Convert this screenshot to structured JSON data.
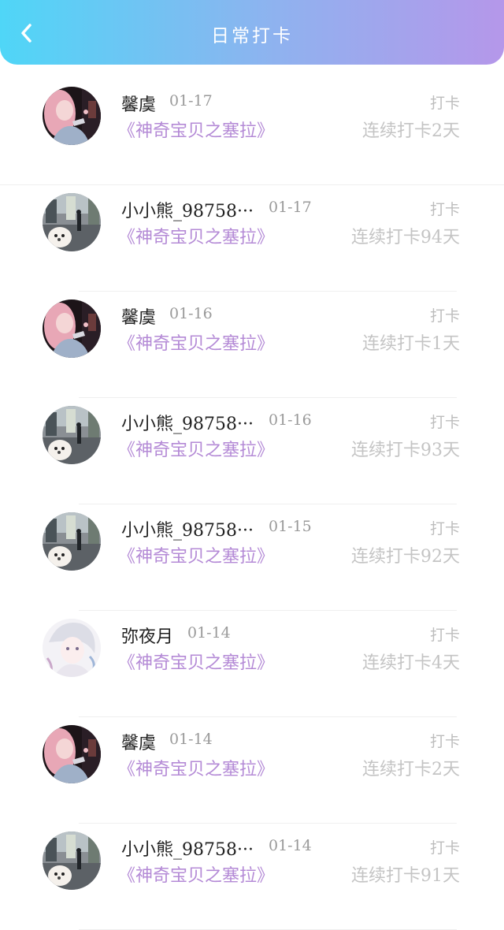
{
  "header": {
    "title": "日常打卡",
    "gradient_start": "#4fd6f7",
    "gradient_end": "#b597ea",
    "back_icon": "chevron-left-icon"
  },
  "items": [
    {
      "user": "馨虞",
      "date": "01-17",
      "book": "《神奇宝贝之塞拉》",
      "tag": "打卡",
      "streak": "连续打卡2天",
      "avatar": "avatar-girl-pink"
    },
    {
      "user": "小小熊_98758···",
      "date": "01-17",
      "book": "《神奇宝贝之塞拉》",
      "tag": "打卡",
      "streak": "连续打卡94天",
      "avatar": "avatar-dog-street"
    },
    {
      "user": "馨虞",
      "date": "01-16",
      "book": "《神奇宝贝之塞拉》",
      "tag": "打卡",
      "streak": "连续打卡1天",
      "avatar": "avatar-girl-pink"
    },
    {
      "user": "小小熊_98758···",
      "date": "01-16",
      "book": "《神奇宝贝之塞拉》",
      "tag": "打卡",
      "streak": "连续打卡93天",
      "avatar": "avatar-dog-street"
    },
    {
      "user": "小小熊_98758···",
      "date": "01-15",
      "book": "《神奇宝贝之塞拉》",
      "tag": "打卡",
      "streak": "连续打卡92天",
      "avatar": "avatar-dog-street"
    },
    {
      "user": "弥夜月",
      "date": "01-14",
      "book": "《神奇宝贝之塞拉》",
      "tag": "打卡",
      "streak": "连续打卡4天",
      "avatar": "avatar-anime-girl"
    },
    {
      "user": "馨虞",
      "date": "01-14",
      "book": "《神奇宝贝之塞拉》",
      "tag": "打卡",
      "streak": "连续打卡2天",
      "avatar": "avatar-girl-pink"
    },
    {
      "user": "小小熊_98758···",
      "date": "01-14",
      "book": "《神奇宝贝之塞拉》",
      "tag": "打卡",
      "streak": "连续打卡91天",
      "avatar": "avatar-dog-street"
    }
  ],
  "colors": {
    "book_title": "#b48ad6",
    "streak": "#c4c4c4",
    "date": "#9a9a9a"
  }
}
